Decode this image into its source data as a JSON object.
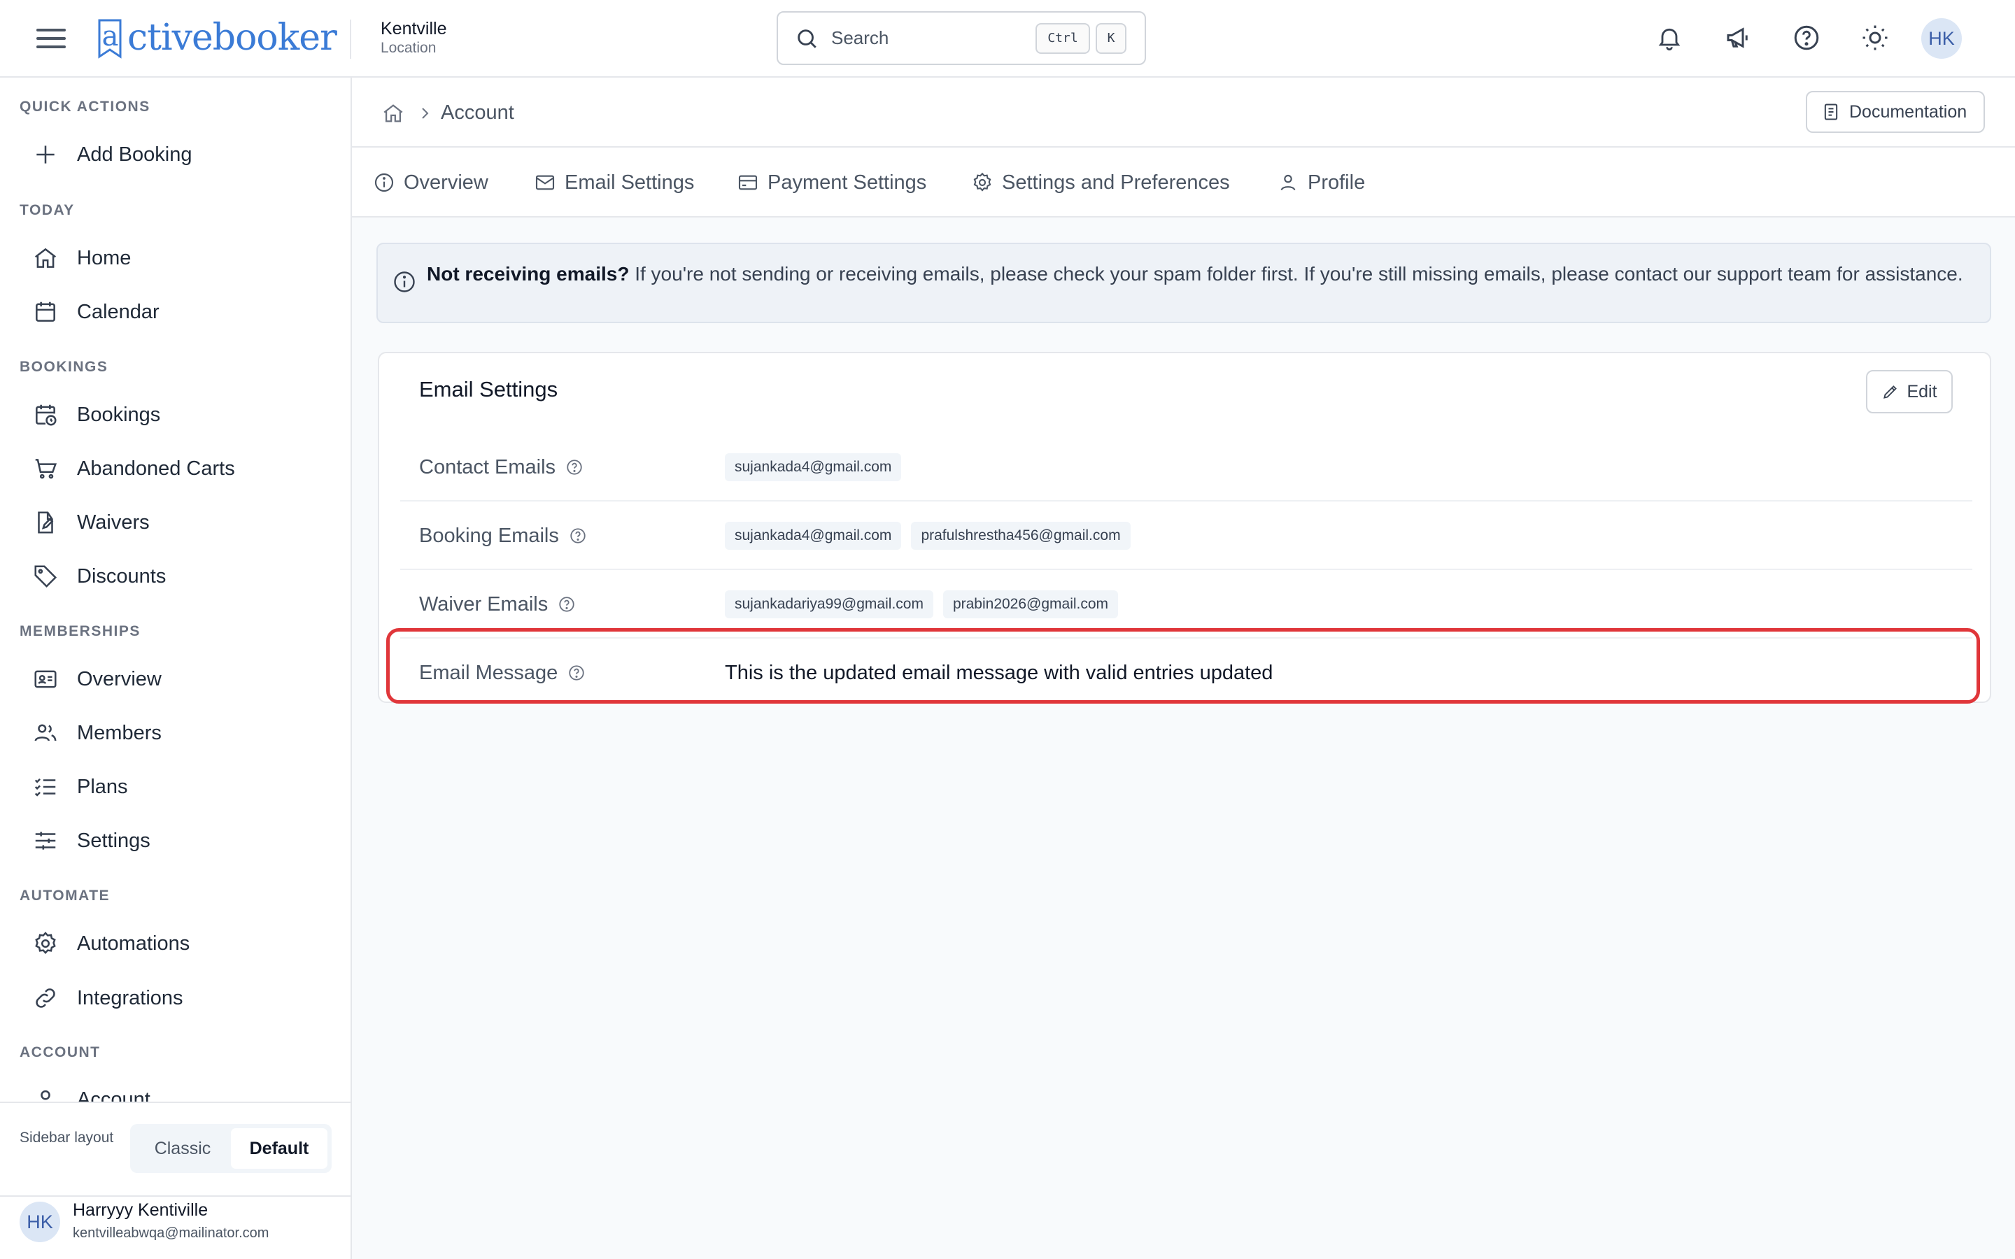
{
  "header": {
    "logo_text": "activebooker",
    "location": {
      "name": "Kentville",
      "label": "Location"
    },
    "search": {
      "placeholder": "Search",
      "shortcut_ctrl": "Ctrl",
      "shortcut_key": "K"
    },
    "user_initials": "HK"
  },
  "sidebar": {
    "sections": {
      "quick_actions": "QUICK ACTIONS",
      "today": "TODAY",
      "bookings": "BOOKINGS",
      "memberships": "MEMBERSHIPS",
      "automate": "AUTOMATE",
      "account": "ACCOUNT"
    },
    "items": {
      "add_booking": "Add Booking",
      "home": "Home",
      "calendar": "Calendar",
      "bookings": "Bookings",
      "abandoned_carts": "Abandoned Carts",
      "waivers": "Waivers",
      "discounts": "Discounts",
      "overview": "Overview",
      "members": "Members",
      "plans": "Plans",
      "settings": "Settings",
      "automations": "Automations",
      "integrations": "Integrations",
      "account": "Account"
    },
    "layout_label": "Sidebar layout",
    "layout_options": {
      "classic": "Classic",
      "default": "Default"
    },
    "user": {
      "initials": "HK",
      "name": "Harryyy Kentiville",
      "email": "kentvilleabwqa@mailinator.com"
    }
  },
  "main": {
    "breadcrumb_current": "Account",
    "documentation_label": "Documentation",
    "tabs": {
      "overview": "Overview",
      "email_settings": "Email Settings",
      "payment_settings": "Payment Settings",
      "settings_preferences": "Settings and Preferences",
      "profile": "Profile"
    },
    "alert": {
      "title": "Not receiving emails?",
      "message": " If you're not sending or receiving emails, please check your spam folder first. If you're still missing emails, please contact our support team for assistance."
    },
    "card": {
      "title": "Email Settings",
      "edit_label": "Edit",
      "rows": {
        "contact": {
          "label": "Contact Emails",
          "values": [
            "sujankada4@gmail.com"
          ]
        },
        "booking": {
          "label": "Booking Emails",
          "values": [
            "sujankada4@gmail.com",
            "prafulshrestha456@gmail.com"
          ]
        },
        "waiver": {
          "label": "Waiver Emails",
          "values": [
            "sujankadariya99@gmail.com",
            "prabin2026@gmail.com"
          ]
        },
        "message": {
          "label": "Email Message",
          "value": "This is the updated email message with valid entries updated"
        }
      }
    }
  },
  "colors": {
    "brand": "#3b7bd6",
    "highlight": "#e0363a"
  }
}
